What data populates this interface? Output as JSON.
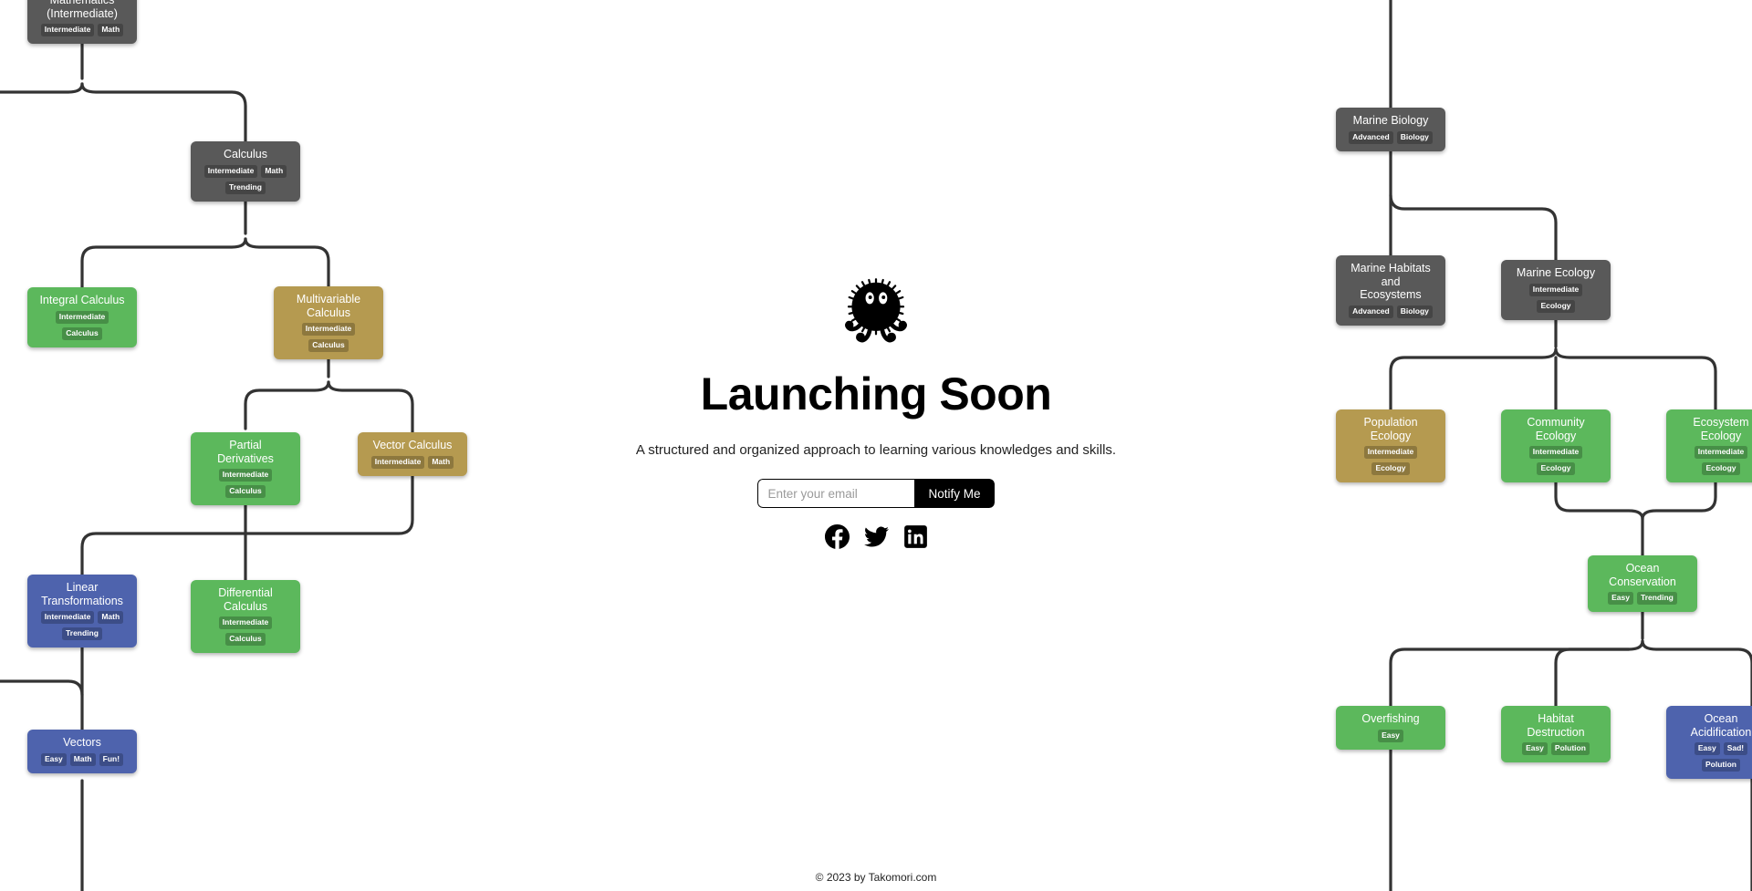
{
  "hero": {
    "mascot_icon": "soot-sprite-icon",
    "title": "Launching Soon",
    "subtitle": "A structured and organized approach to learning various knowledges and skills.",
    "email_placeholder": "Enter your email",
    "email_value": "",
    "notify_label": "Notify Me",
    "social": [
      {
        "icon": "facebook-icon",
        "name": "Facebook"
      },
      {
        "icon": "twitter-icon",
        "name": "Twitter"
      },
      {
        "icon": "linkedin-icon",
        "name": "LinkedIn"
      }
    ]
  },
  "footer": {
    "copyright": "© 2023 by Takomori.com"
  },
  "colors": {
    "gray": "#595959",
    "green": "#5cb85c",
    "khaki": "#b59a50",
    "blue": "#4e63ad",
    "edge": "#333333",
    "button": "#000000",
    "background": "#ffffff"
  },
  "tree": {
    "nodes": [
      {
        "id": "mathematics",
        "title": "Mathematics\n(Intermediate)",
        "tags": [
          "Intermediate",
          "Math"
        ],
        "color": "gray"
      },
      {
        "id": "calculus",
        "title": "Calculus",
        "tags": [
          "Intermediate",
          "Math",
          "Trending"
        ],
        "color": "gray"
      },
      {
        "id": "integral-calculus",
        "title": "Integral Calculus",
        "tags": [
          "Intermediate",
          "Calculus"
        ],
        "color": "green"
      },
      {
        "id": "multivariable-calculus",
        "title": "Multivariable\nCalculus",
        "tags": [
          "Intermediate",
          "Calculus"
        ],
        "color": "khaki"
      },
      {
        "id": "partial-derivatives",
        "title": "Partial Derivatives",
        "tags": [
          "Intermediate",
          "Calculus"
        ],
        "color": "green"
      },
      {
        "id": "vector-calculus",
        "title": "Vector Calculus",
        "tags": [
          "Intermediate",
          "Math"
        ],
        "color": "khaki"
      },
      {
        "id": "linear-transformations",
        "title": "Linear\nTransformations",
        "tags": [
          "Intermediate",
          "Math",
          "Trending"
        ],
        "color": "blue"
      },
      {
        "id": "differential-calculus",
        "title": "Differential Calculus",
        "tags": [
          "Intermediate",
          "Calculus"
        ],
        "color": "green"
      },
      {
        "id": "vectors",
        "title": "Vectors",
        "tags": [
          "Easy",
          "Math",
          "Fun!"
        ],
        "color": "blue"
      },
      {
        "id": "marine-biology",
        "title": "Marine Biology",
        "tags": [
          "Advanced",
          "Biology"
        ],
        "color": "gray"
      },
      {
        "id": "marine-habitats",
        "title": "Marine Habitats and\nEcosystems",
        "tags": [
          "Advanced",
          "Biology"
        ],
        "color": "gray"
      },
      {
        "id": "marine-ecology",
        "title": "Marine Ecology",
        "tags": [
          "Intermediate",
          "Ecology"
        ],
        "color": "gray"
      },
      {
        "id": "population-ecology",
        "title": "Population Ecology",
        "tags": [
          "Intermediate",
          "Ecology"
        ],
        "color": "khaki"
      },
      {
        "id": "community-ecology",
        "title": "Community Ecology",
        "tags": [
          "Intermediate",
          "Ecology"
        ],
        "color": "green"
      },
      {
        "id": "ecosystem-ecology",
        "title": "Ecosystem Ecology",
        "tags": [
          "Intermediate",
          "Ecology"
        ],
        "color": "green"
      },
      {
        "id": "ocean-conservation",
        "title": "Ocean Conservation",
        "tags": [
          "Easy",
          "Trending"
        ],
        "color": "green"
      },
      {
        "id": "overfishing",
        "title": "Overfishing",
        "tags": [
          "Easy"
        ],
        "color": "green"
      },
      {
        "id": "habitat-destruction",
        "title": "Habitat Destruction",
        "tags": [
          "Easy",
          "Polution"
        ],
        "color": "green"
      },
      {
        "id": "ocean-acidification",
        "title": "Ocean Acidification",
        "tags": [
          "Easy",
          "Sad!",
          "Polution"
        ],
        "color": "blue"
      }
    ]
  }
}
